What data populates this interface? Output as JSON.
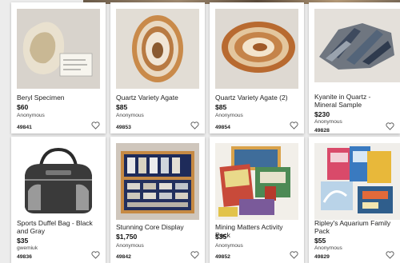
{
  "listings": [
    {
      "title": "Beryl Specimen",
      "price": "$60",
      "seller": "Anonymous",
      "lot": "49841"
    },
    {
      "title": "Quartz Variety Agate",
      "price": "$85",
      "seller": "Anonymous",
      "lot": "49853"
    },
    {
      "title": "Quartz Variety Agate (2)",
      "price": "$85",
      "seller": "Anonymous",
      "lot": "49854"
    },
    {
      "title": "Kyanite in Quartz - Mineral Sample",
      "price": "$230",
      "seller": "Anonymous",
      "lot": "49828"
    },
    {
      "title": "Sports Duffel Bag - Black and Gray",
      "price": "$35",
      "seller": "gwemiuk",
      "lot": "49836"
    },
    {
      "title": "Stunning Core Display",
      "price": "$1,750",
      "seller": "Anonymous",
      "lot": "49842"
    },
    {
      "title": "Mining Matters Activity Pack",
      "price": "$35",
      "seller": "Anonymous",
      "lot": "49852"
    },
    {
      "title": "Ripley's Aquarium Family Pack",
      "price": "$55",
      "seller": "Anonymous",
      "lot": "49829"
    }
  ],
  "icons": {
    "favorite": "heart-outline-icon"
  }
}
